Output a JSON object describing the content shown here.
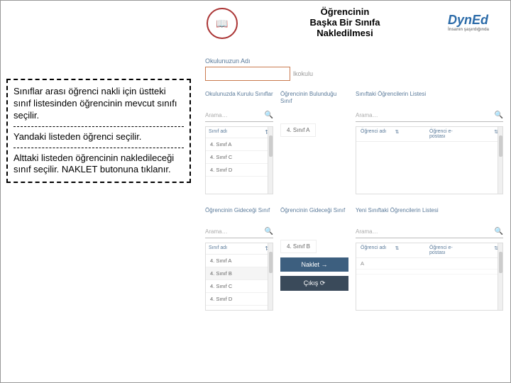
{
  "header": {
    "title_l1": "Öğrencinin",
    "title_l2": "Başka Bir Sınıfa",
    "title_l3": "Nakledilmesi",
    "dyned": "DynEd",
    "dyned_sub": "İnsanın şaşırdığında"
  },
  "annotation": {
    "p1": "Sınıflar arası öğrenci nakli için üstteki sınıf listesinden öğrencinin mevcut sınıfı seçilir.",
    "p2": "Yandaki listeden öğrenci seçilir.",
    "p3": "Alttaki listeden öğrencinin nakledileceği sınıf seçilir. NAKLET butonuna tıklanır."
  },
  "school": {
    "label": "Okulunuzun Adı",
    "value": "",
    "rest": "lkokulu"
  },
  "top": {
    "col_a": {
      "title": "Okulunuzda Kurulu Sınıflar",
      "search": "Arama…",
      "list_header": "Sınıf adı",
      "items": [
        "4. Sınıf A",
        "4. Sınıf C",
        "4. Sınıf D"
      ]
    },
    "col_b": {
      "title": "Öğrencinin Bulunduğu Sınıf",
      "chip": "4. Sınıf A"
    },
    "col_c": {
      "title": "Sınıftaki Öğrencilerin Listesi",
      "search": "Arama…",
      "h1": "Öğrenci adı",
      "h2": "Öğrenci e-postası"
    }
  },
  "bottom": {
    "col_a": {
      "title": "Öğrencinin Gideceği Sınıf",
      "search": "Arama…",
      "list_header": "Sınıf adı",
      "items": [
        "4. Sınıf A",
        "4. Sınıf B",
        "4. Sınıf C",
        "4. Sınıf D"
      ]
    },
    "col_b": {
      "title": "Öğrencinin Gideceği Sınıf",
      "chip": "4. Sınıf B",
      "btn_naklet": "Naklet →",
      "btn_cikis": "Çıkış ⟳"
    },
    "col_c": {
      "title": "Yeni Sınıftaki Öğrencilerin Listesi",
      "search": "Arama…",
      "h1": "Öğrenci adı",
      "h2": "Öğrenci e-postası",
      "items": [
        "A",
        " "
      ]
    }
  },
  "icons": {
    "sort": "⇅",
    "mag": "🔍"
  }
}
